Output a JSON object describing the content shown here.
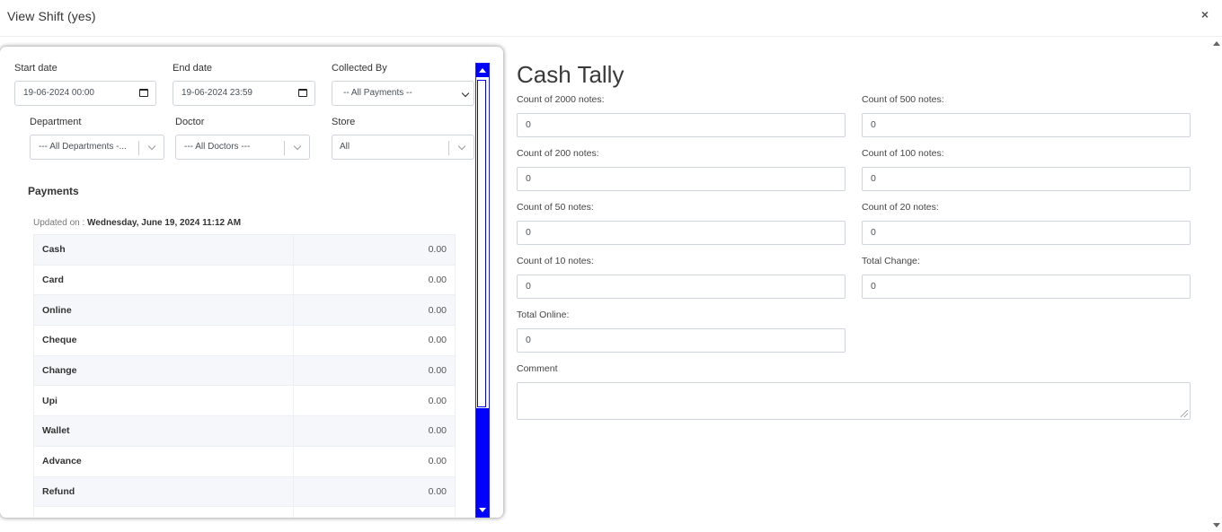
{
  "modal": {
    "title": "View Shift (yes)",
    "close": "×"
  },
  "filters": {
    "start_date": {
      "label": "Start date",
      "value": "19-06-2024 00:00"
    },
    "end_date": {
      "label": "End date",
      "value": "19-06-2024 23:59"
    },
    "collected_by": {
      "label": "Collected By",
      "value": "-- All Payments --"
    },
    "department": {
      "label": "Department",
      "value": "--- All Departments -..."
    },
    "doctor": {
      "label": "Doctor",
      "value": "--- All Doctors ---"
    },
    "store": {
      "label": "Store",
      "value": "All"
    }
  },
  "payments": {
    "title": "Payments",
    "updated_prefix": "Updated on :",
    "updated_value": "Wednesday, June 19, 2024 11:12 AM",
    "rows": [
      {
        "label": "Cash",
        "value": "0.00"
      },
      {
        "label": "Card",
        "value": "0.00"
      },
      {
        "label": "Online",
        "value": "0.00"
      },
      {
        "label": "Cheque",
        "value": "0.00"
      },
      {
        "label": "Change",
        "value": "0.00"
      },
      {
        "label": "Upi",
        "value": "0.00"
      },
      {
        "label": "Wallet",
        "value": "0.00"
      },
      {
        "label": "Advance",
        "value": "0.00"
      },
      {
        "label": "Refund",
        "value": "0.00"
      },
      {
        "label": "",
        "value": ""
      }
    ]
  },
  "tally": {
    "title": "Cash Tally",
    "fields": [
      {
        "label": "Count of 2000 notes:",
        "value": "0"
      },
      {
        "label": "Count of 500 notes:",
        "value": "0"
      },
      {
        "label": "Count of 200 notes:",
        "value": "0"
      },
      {
        "label": "Count of 100 notes:",
        "value": "0"
      },
      {
        "label": "Count of 50 notes:",
        "value": "0"
      },
      {
        "label": "Count of 20 notes:",
        "value": "0"
      },
      {
        "label": "Count of 10 notes:",
        "value": "0"
      },
      {
        "label": "Total Change:",
        "value": "0"
      },
      {
        "label": "Total Online:",
        "value": "0"
      }
    ],
    "comment_label": "Comment",
    "comment_value": ""
  },
  "colors": {
    "scrollbar": "#0000ff",
    "border": "#ced4da"
  }
}
